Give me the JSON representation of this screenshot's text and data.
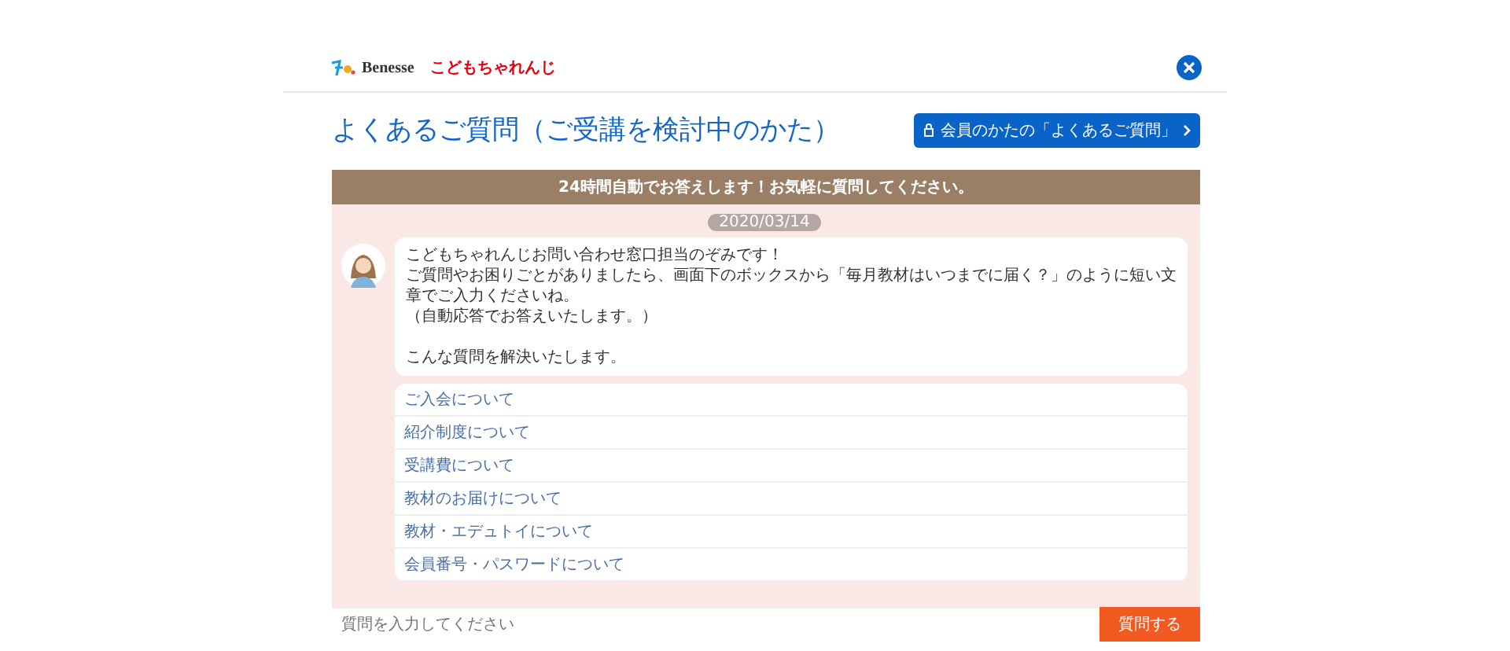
{
  "header": {
    "brand": "Benesse",
    "product": "こどもちゃれんじ"
  },
  "title": "よくあるご質問（ご受講を検討中のかた）",
  "member_faq_button": "会員のかたの「よくあるご質問」",
  "chat": {
    "banner": "24時間自動でお答えします！お気軽に質問してください。",
    "date": "2020/03/14",
    "message": [
      "こどもちゃれんじお問い合わせ窓口担当のぞみです！",
      "ご質問やお困りごとがありましたら、画面下のボックスから「毎月教材はいつまでに届く？」のように短い文章でご入力くださいね。",
      "（自動応答でお答えいたします。）",
      "こんな質問を解決いたします。"
    ],
    "topics": [
      {
        "label": "ご入会について"
      },
      {
        "label": "紹介制度について"
      },
      {
        "label": "受講費について"
      },
      {
        "label": "教材のお届けについて"
      },
      {
        "label": "教材・エデュトイについて"
      },
      {
        "label": "会員番号・パスワードについて"
      }
    ],
    "input": {
      "placeholder": "質問を入力してください"
    },
    "send_button": "質問する"
  }
}
